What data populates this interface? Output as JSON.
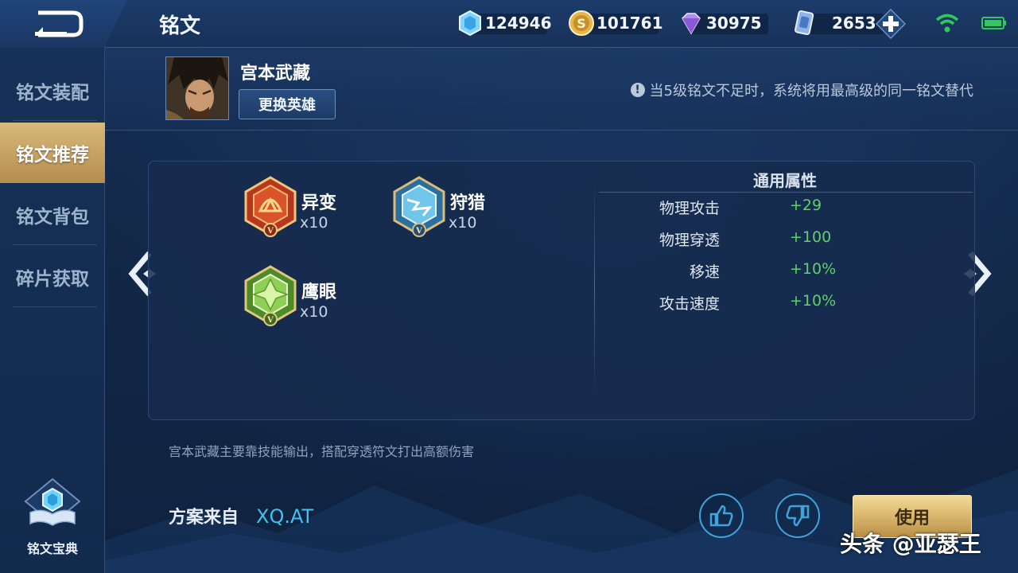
{
  "header": {
    "title": "铭文",
    "currencies": [
      {
        "icon": "diamond-crystal-icon",
        "value": "124946"
      },
      {
        "icon": "gold-coin-icon",
        "value": "101761"
      },
      {
        "icon": "purple-gem-icon",
        "value": "30975"
      },
      {
        "icon": "card-voucher-icon",
        "value": "2653"
      }
    ]
  },
  "sidebar": {
    "items": [
      {
        "label": "铭文装配",
        "active": false
      },
      {
        "label": "铭文推荐",
        "active": true
      },
      {
        "label": "铭文背包",
        "active": false
      },
      {
        "label": "碎片获取",
        "active": false
      }
    ],
    "codex_label": "铭文宝典"
  },
  "hero": {
    "name": "宫本武藏",
    "change_label": "更换英雄",
    "notice": "当5级铭文不足时，系统将用最高级的同一铭文替代"
  },
  "runes": [
    {
      "name": "异变",
      "count": "x10",
      "color": "red"
    },
    {
      "name": "狩猎",
      "count": "x10",
      "color": "blue"
    },
    {
      "name": "鹰眼",
      "count": "x10",
      "color": "green"
    }
  ],
  "attributes": {
    "title": "通用属性",
    "rows": [
      {
        "key": "物理攻击",
        "value": "+29"
      },
      {
        "key": "物理穿透",
        "value": "+100"
      },
      {
        "key": "移速",
        "value": "+10%"
      },
      {
        "key": "攻击速度",
        "value": "+10%"
      }
    ]
  },
  "description": "宫本武藏主要靠技能输出，搭配穿透符文打出高额伤害",
  "source": {
    "label": "方案来自",
    "author": "XQ.AT"
  },
  "actions": {
    "use_label": "使用"
  },
  "watermark": "头条 @亚瑟王",
  "colors": {
    "accent_gold": "#d9b66d",
    "positive_green": "#5fcf6a",
    "link_blue": "#45c1ee"
  }
}
